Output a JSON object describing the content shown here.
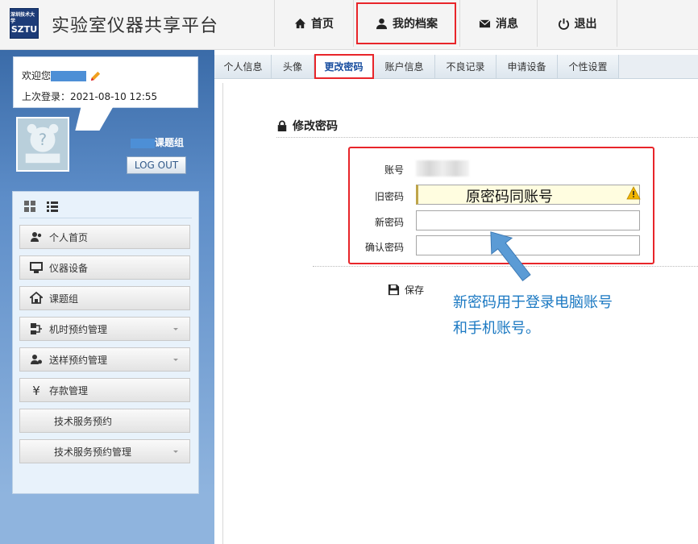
{
  "header": {
    "logo_text": "SZTU",
    "logo_small": "深圳技术大学",
    "title": "实验室仪器共享平台",
    "nav": [
      {
        "label": "首页",
        "icon": "home-icon"
      },
      {
        "label": "我的档案",
        "icon": "user-icon"
      },
      {
        "label": "消息",
        "icon": "envelope-icon"
      },
      {
        "label": "退出",
        "icon": "power-icon"
      }
    ]
  },
  "sidebar": {
    "welcome_prefix": "欢迎您",
    "last_login": "上次登录：2021-08-10 12:55",
    "group_suffix": "课题组",
    "logout_label": "LOG OUT",
    "menu": [
      {
        "label": "个人首页",
        "icon": "users-icon",
        "chevron": false
      },
      {
        "label": "仪器设备",
        "icon": "monitor-icon",
        "chevron": false
      },
      {
        "label": "课题组",
        "icon": "house-icon",
        "chevron": false
      },
      {
        "label": "机时预约管理",
        "icon": "network-icon",
        "chevron": true
      },
      {
        "label": "送样预约管理",
        "icon": "user-gear-icon",
        "chevron": true
      },
      {
        "label": "存款管理",
        "icon": "yen-icon",
        "chevron": false
      },
      {
        "label": "技术服务预约",
        "icon": "",
        "chevron": false
      },
      {
        "label": "技术服务预约管理",
        "icon": "",
        "chevron": true
      }
    ]
  },
  "tabs": [
    {
      "label": "个人信息"
    },
    {
      "label": "头像"
    },
    {
      "label": "更改密码"
    },
    {
      "label": "账户信息"
    },
    {
      "label": "不良记录"
    },
    {
      "label": "申请设备"
    },
    {
      "label": "个性设置"
    }
  ],
  "form": {
    "section_title": "修改密码",
    "account_label": "账号",
    "old_password_label": "旧密码",
    "new_password_label": "新密码",
    "confirm_password_label": "确认密码",
    "old_password_hint": "原密码同账号",
    "save_label": "保存"
  },
  "annotation": {
    "line1": "新密码用于登录电脑账号",
    "line2": "和手机账号。"
  },
  "colors": {
    "highlight_red": "#e8252a",
    "annotation_blue": "#1a78c2",
    "sidebar_blue": "#3a6ba8"
  }
}
